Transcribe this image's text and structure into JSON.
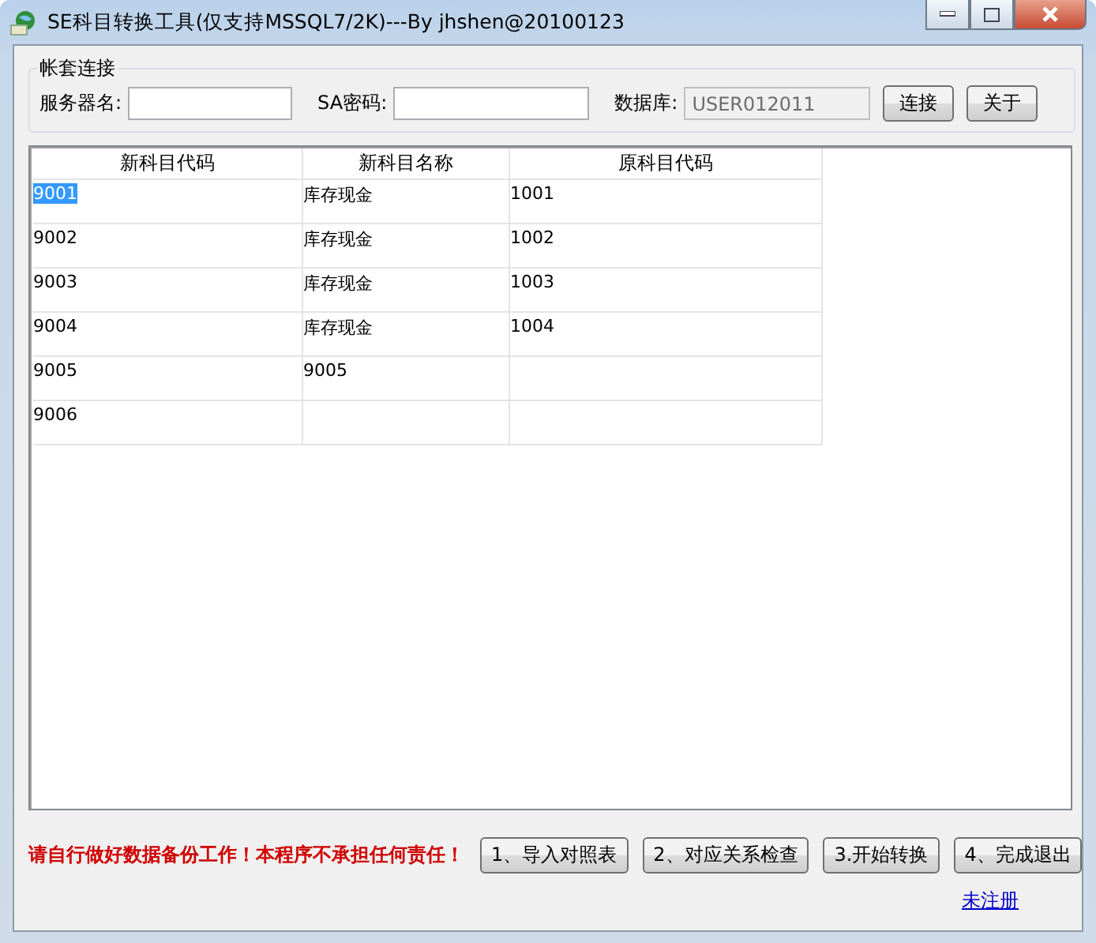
{
  "window": {
    "title": "SE科目转换工具(仅支持MSSQL7/2K)---By jhshen@20100123"
  },
  "connection": {
    "title": "帐套连接",
    "fields": [
      {
        "label": "服务器名:",
        "disabled": false
      },
      {
        "label": "SA密码:",
        "disabled": false
      },
      {
        "label": "数据库:",
        "value": "USER012011",
        "disabled": true
      }
    ],
    "buttons": [
      "连接",
      "关于"
    ]
  },
  "table": {
    "columns": [
      "新科目代码",
      "新科目名称",
      "原科目代码"
    ],
    "rows": [
      {
        "cells": [
          "9001",
          "库存现金",
          "1001"
        ],
        "selected": true
      },
      {
        "cells": [
          "9002",
          "库存现金",
          "1002"
        ],
        "selected": false
      },
      {
        "cells": [
          "9003",
          "库存现金",
          "1003"
        ],
        "selected": false
      },
      {
        "cells": [
          "9004",
          "库存现金",
          "1004"
        ],
        "selected": false
      },
      {
        "cells": [
          "9005",
          "9005"
        ],
        "selected": false
      },
      {
        "cells": [
          "9006"
        ],
        "selected": false
      }
    ]
  },
  "warning": "请自行做好数据备份工作！本程序不承担任何责任！",
  "actions": [
    "1、导入对照表",
    "2、对应关系检查",
    "3.开始转换",
    "4、完成退出"
  ],
  "register_link": "未注册"
}
